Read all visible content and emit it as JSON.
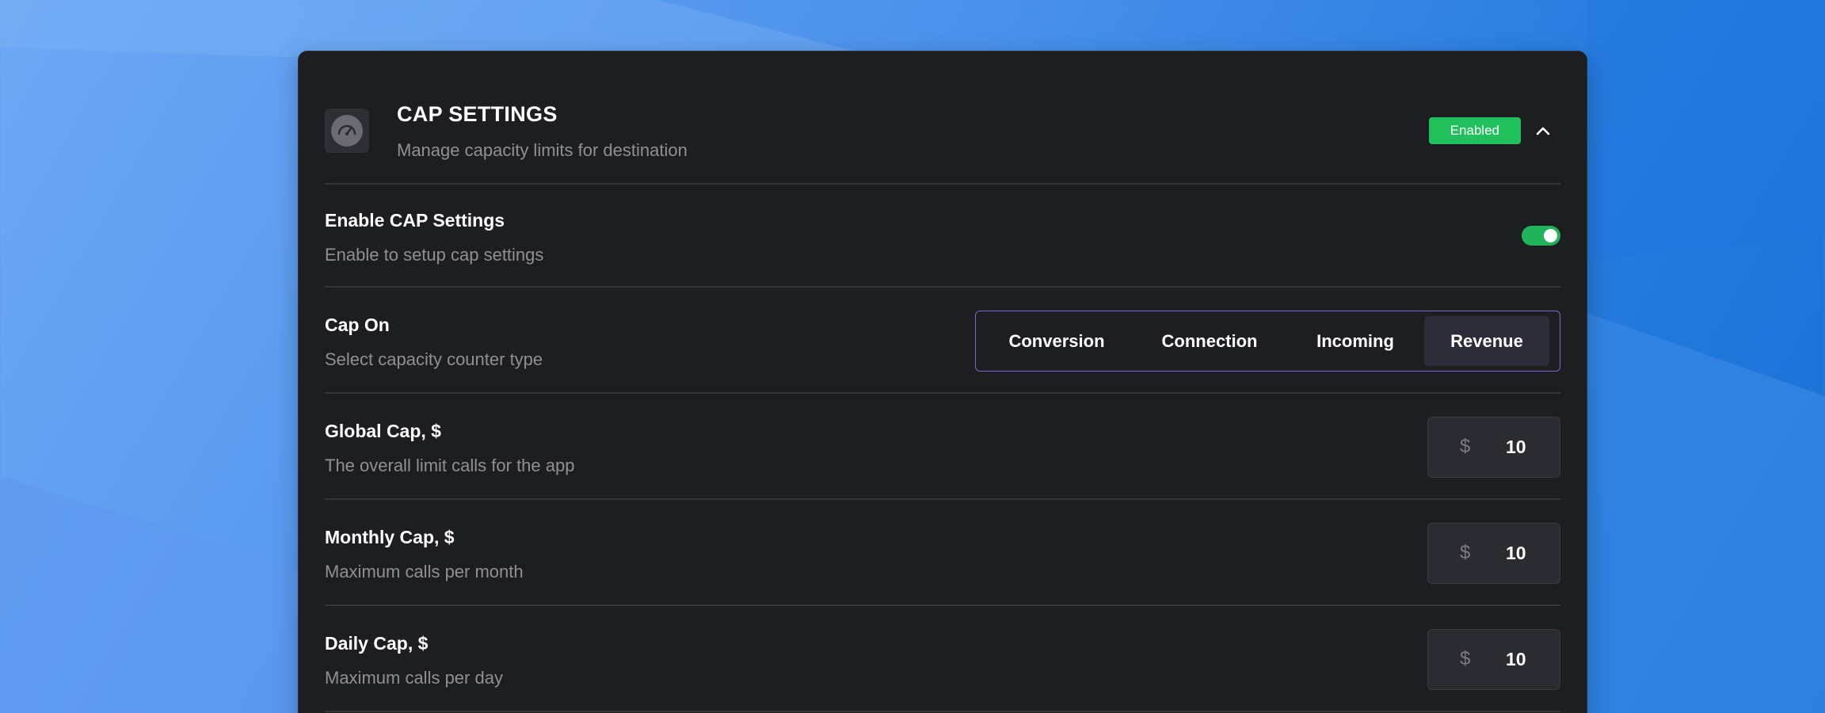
{
  "header": {
    "icon": "speedometer-icon",
    "title": "CAP SETTINGS",
    "subtitle": "Manage capacity limits for destination",
    "badge": "Enabled",
    "badge_color": "#20c05c",
    "collapse_icon": "chevron-up-icon"
  },
  "enable_row": {
    "title": "Enable CAP Settings",
    "subtitle": "Enable to setup cap settings",
    "toggle_on": true,
    "toggle_color": "#20b35a"
  },
  "cap_on": {
    "title": "Cap On",
    "subtitle": "Select capacity counter type",
    "options": [
      "Conversion",
      "Connection",
      "Incoming",
      "Revenue"
    ],
    "selected": "Revenue",
    "accent_color": "#7a68c8"
  },
  "caps": [
    {
      "title": "Global Cap, $",
      "subtitle": "The overall limit calls for the app",
      "currency": "$",
      "value": "10"
    },
    {
      "title": "Monthly Cap, $",
      "subtitle": "Maximum calls per month",
      "currency": "$",
      "value": "10"
    },
    {
      "title": "Daily Cap, $",
      "subtitle": "Maximum calls per day",
      "currency": "$",
      "value": "10"
    }
  ]
}
